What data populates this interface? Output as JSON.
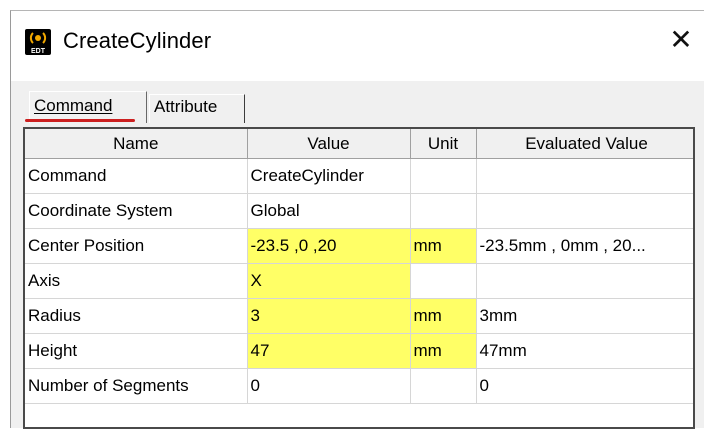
{
  "window": {
    "title": "CreateCylinder",
    "close_glyph": "✕",
    "app_icon": "edt-app-icon",
    "app_icon_text": "EDT"
  },
  "tabs": [
    {
      "label": "Command",
      "active": true
    },
    {
      "label": "Attribute",
      "active": false
    }
  ],
  "colors": {
    "highlight": "#ffff66",
    "tab_underline": "#cc1f1f"
  },
  "table": {
    "columns": [
      "Name",
      "Value",
      "Unit",
      "Evaluated Value"
    ],
    "rows": [
      {
        "name": "Command",
        "value": "CreateCylinder",
        "unit": "",
        "evaluated": ""
      },
      {
        "name": "Coordinate System",
        "value": "Global",
        "unit": "",
        "evaluated": ""
      },
      {
        "name": "Center Position",
        "value": "-23.5 ,0 ,20",
        "unit": "mm",
        "evaluated": "-23.5mm , 0mm , 20..."
      },
      {
        "name": "Axis",
        "value": "X",
        "unit": "",
        "evaluated": ""
      },
      {
        "name": "Radius",
        "value": "3",
        "unit": "mm",
        "evaluated": "3mm"
      },
      {
        "name": "Height",
        "value": "47",
        "unit": "mm",
        "evaluated": "47mm"
      },
      {
        "name": "Number of Segments",
        "value": "0",
        "unit": "",
        "evaluated": "0"
      }
    ]
  }
}
